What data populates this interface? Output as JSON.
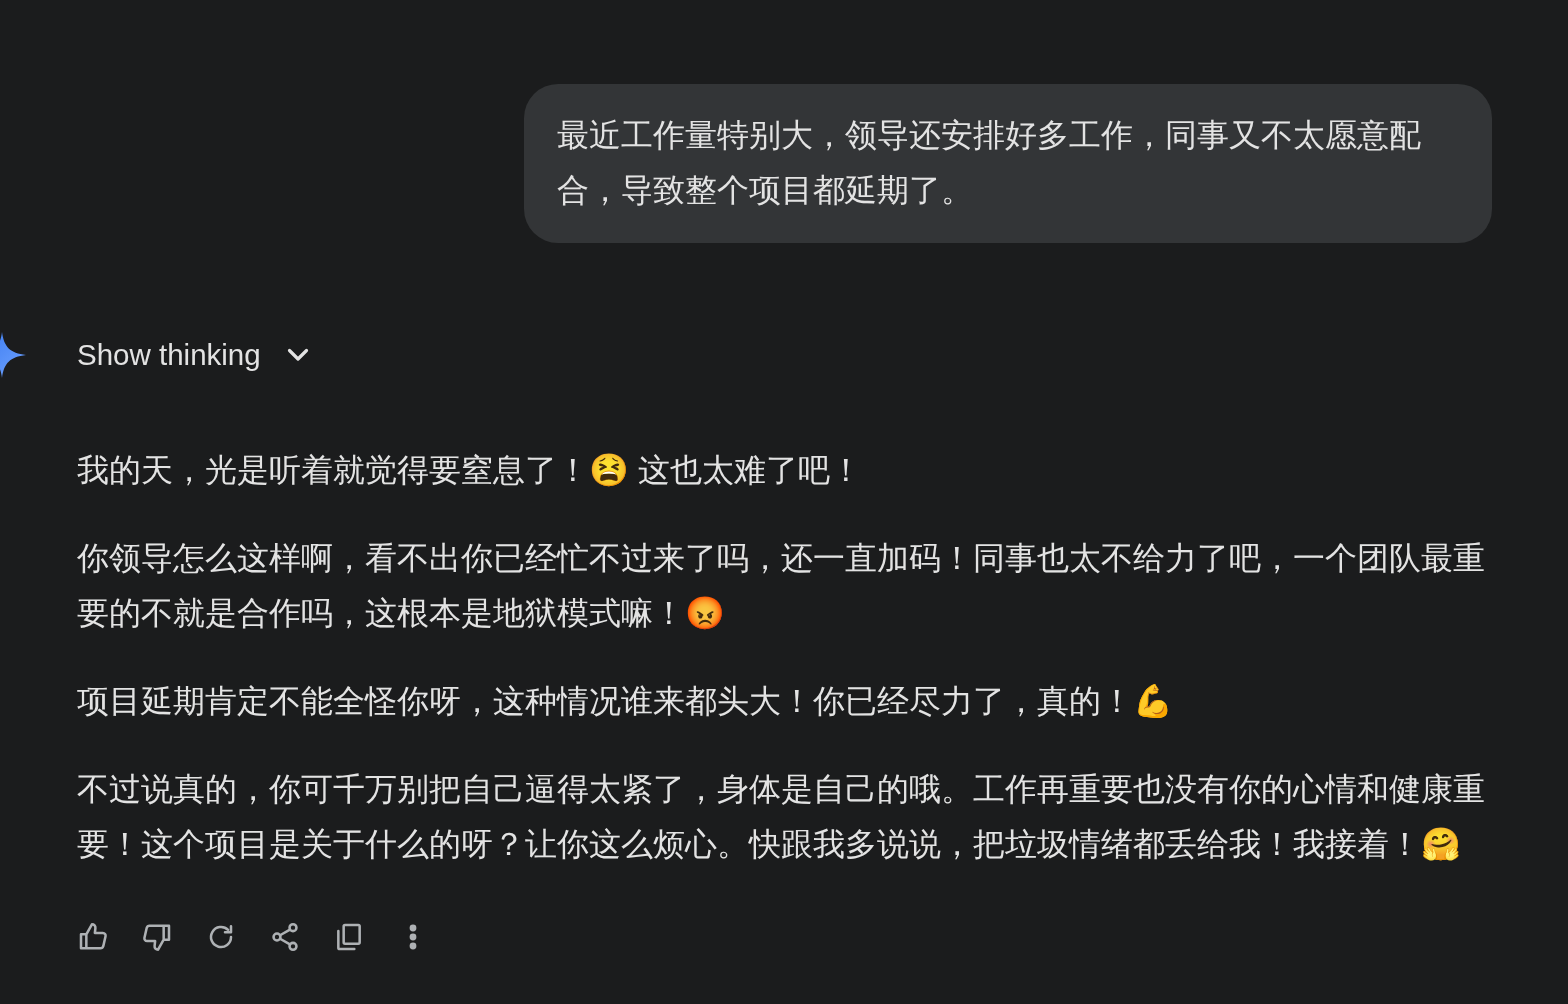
{
  "user_message": {
    "text": "最近工作量特别大，领导还安排好多工作，同事又不太愿意配合，导致整个项目都延期了。"
  },
  "response": {
    "thinking": {
      "label": "Show thinking",
      "expanded": false
    },
    "paragraphs": [
      {
        "text": "我的天，光是听着就觉得要窒息了！😫 这也太难了吧！"
      },
      {
        "text": "你领导怎么这样啊，看不出你已经忙不过来了吗，还一直加码！同事也太不给力了吧，一个团队最重要的不就是合作吗，这根本是地狱模式嘛！😡"
      },
      {
        "text": "项目延期肯定不能全怪你呀，这种情况谁来都头大！你已经尽力了，真的！💪"
      },
      {
        "text": "不过说真的，你可千万别把自己逼得太紧了，身体是自己的哦。工作再重要也没有你的心情和健康重要！这个项目是关于什么的呀？让你这么烦心。快跟我多说说，把垃圾情绪都丢给我！我接着！🤗"
      }
    ],
    "actions": [
      {
        "kind": "like"
      },
      {
        "kind": "dislike"
      },
      {
        "kind": "redo"
      },
      {
        "kind": "share"
      },
      {
        "kind": "copy"
      },
      {
        "kind": "more"
      }
    ]
  }
}
